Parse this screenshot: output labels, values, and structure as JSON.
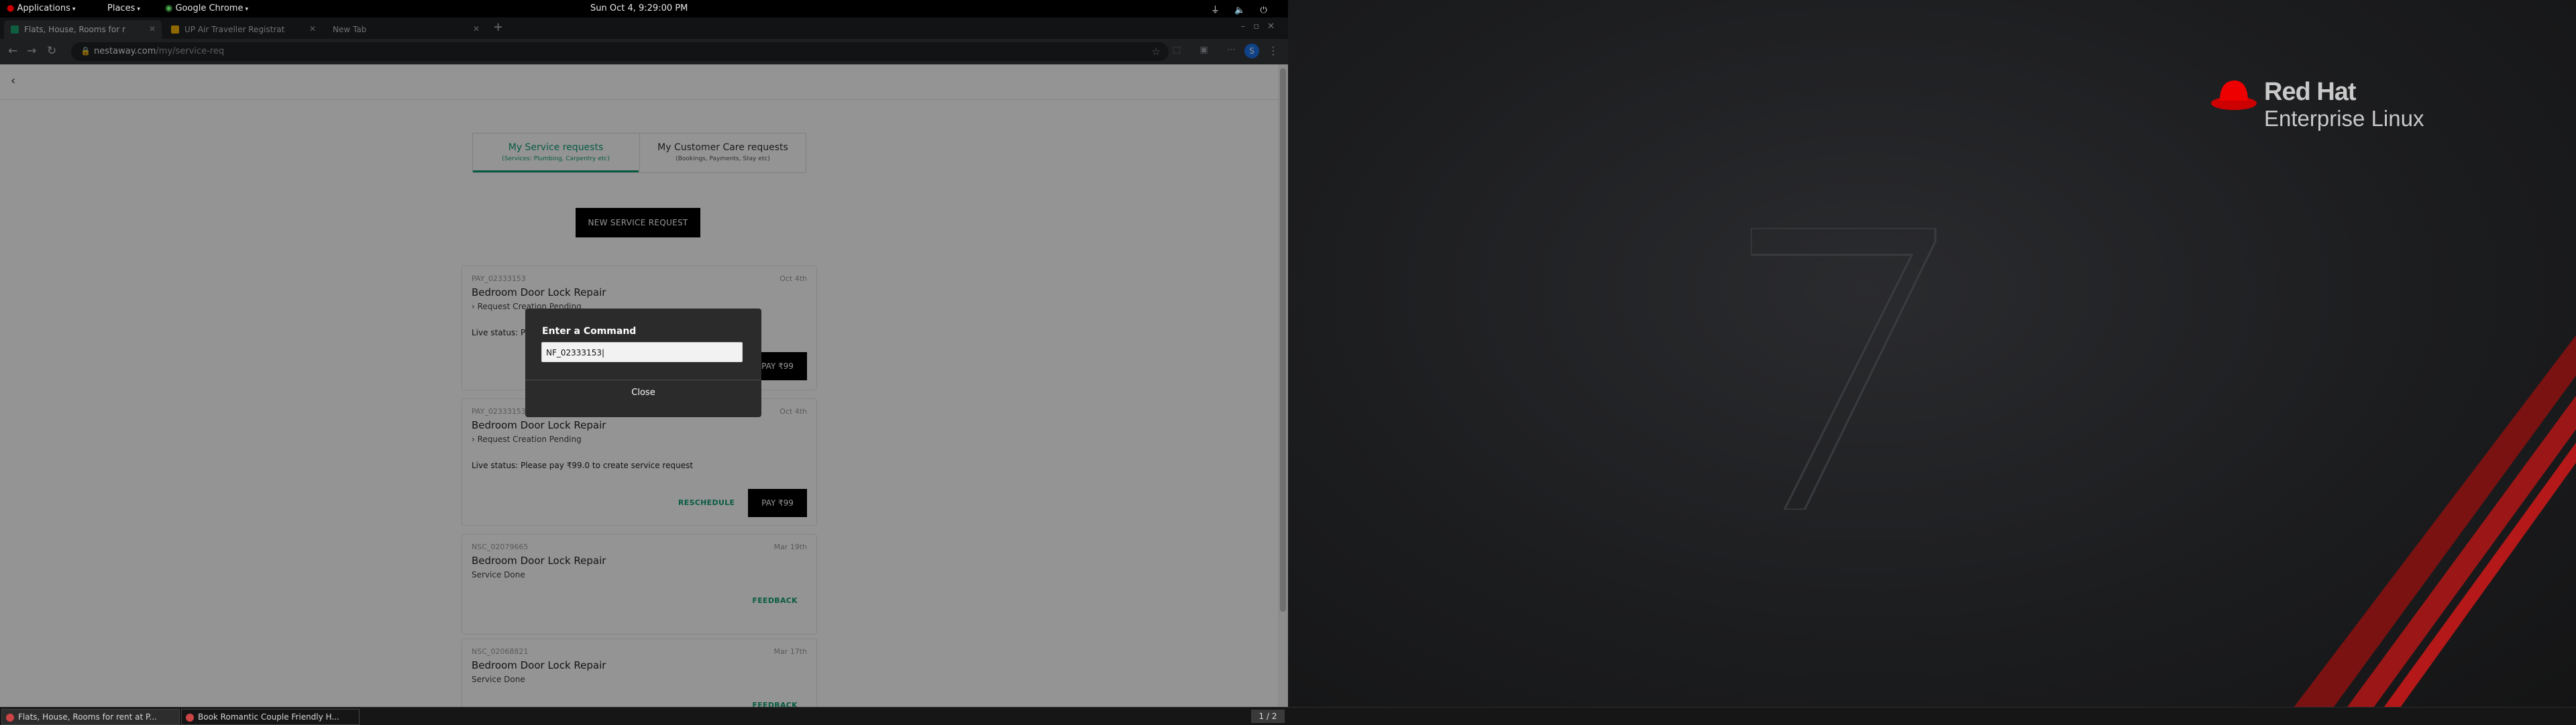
{
  "topbar": {
    "applications": "Applications",
    "places": "Places",
    "app_name": "Google Chrome",
    "clock": "Sun Oct  4,  9:29:00 PM",
    "tray": "⏚ 🔈 ⏻"
  },
  "browser": {
    "tabs": [
      {
        "title": "Flats, House, Rooms for r",
        "favicon_color": "#1aa36f",
        "active": true
      },
      {
        "title": "UP Air Traveller Registrat",
        "favicon_color": "#f5b400",
        "active": false
      },
      {
        "title": "New Tab",
        "favicon_color": "",
        "active": false
      }
    ],
    "new_tab": "+",
    "window_controls": "–▫✕",
    "url_host": "nestaway.com",
    "url_path": "/my/service-req",
    "extensions": "⬚ ▣ ⋯",
    "profile_initial": "S"
  },
  "page": {
    "back": "‹",
    "segments": [
      {
        "label": "My Service requests",
        "sub": "(Services: Plumbing, Carpentry etc)"
      },
      {
        "label": "My Customer Care requests",
        "sub": "(Bookings, Payments, Stay etc)"
      }
    ],
    "new_request_button": "NEW SERVICE REQUEST",
    "cards": [
      {
        "id": "PAY_02333153",
        "date": "Oct 4th",
        "title": "Bedroom Door Lock Repair",
        "status": "Request Creation Pending",
        "live": "Live status: P",
        "pay": "PAY ₹99"
      },
      {
        "id": "PAY_02333153",
        "date": "Oct 4th",
        "title": "Bedroom Door Lock Repair",
        "status": "Request Creation Pending",
        "live": "Live status: Please pay ₹99.0 to create service request",
        "reschedule": "RESCHEDULE",
        "pay": "PAY ₹99"
      },
      {
        "id": "NSC_02079665",
        "date": "Mar 19th",
        "title": "Bedroom Door Lock Repair",
        "status": "Service Done",
        "feedback": "FEEDBACK"
      },
      {
        "id": "NSC_02068821",
        "date": "Mar 17th",
        "title": "Bedroom Door Lock Repair",
        "status": "Service Done",
        "feedback": "FEEDBACK"
      }
    ]
  },
  "dialog": {
    "title": "Enter a Command",
    "input_value": "NF_02333153",
    "close": "Close"
  },
  "desktop": {
    "brand_line1": "Red Hat",
    "brand_line2": "Enterprise Linux",
    "version": "7"
  },
  "taskbar": {
    "items": [
      "Flats, House, Rooms for rent at P...",
      "Book Romantic Couple Friendly H..."
    ],
    "workspace": "1 / 2"
  }
}
